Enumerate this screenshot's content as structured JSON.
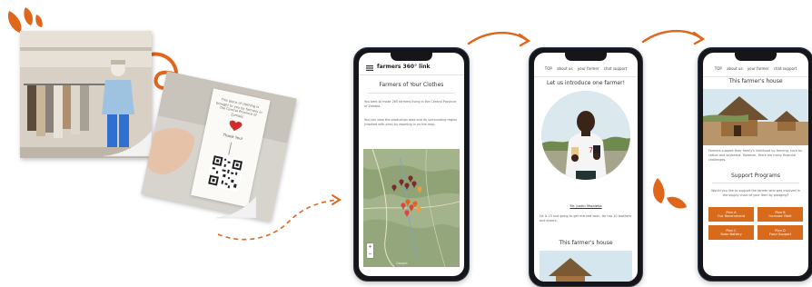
{
  "tag_card": {
    "note": "This piece of clothing is brought to you by farmers in the Central Province of Zambia.",
    "thanks": "Thank You!"
  },
  "phone1": {
    "brand": "farmers 360° link",
    "section_title": "Farmers of Your Clothes",
    "intro": "You bent to make 265 farmers living in the Central Province of Zambia.",
    "map_hint": "You can view the production area and its surrounding region (marked with pins) by zooming in on the map.",
    "zoom_in": "+",
    "zoom_out": "−",
    "map_credit": "Google"
  },
  "phone2": {
    "nav": [
      "TOP",
      "about us",
      "your farmer",
      "chat support"
    ],
    "title": "Let us introduce one farmer!",
    "farmer_name": "Mr. Justin Mwaleka",
    "bio": "He is 23 and going to get married soon. He has 10 brothers and sisters.",
    "house_title": "This farmer's house"
  },
  "phone3": {
    "nav": [
      "TOP",
      "about us",
      "your farmer",
      "chat support"
    ],
    "house_title": "This farmer's house",
    "desc": "Farmers support their family's livelihood by farming, such as cotton and soybeans. However, there are many financial challenges.",
    "support_title": "Support Programs",
    "support_text": "Would you like to support the farmer who was involved in the supply chain of your item by pledging?",
    "plans": [
      {
        "name": "Plan A",
        "desc": "Our Recommend"
      },
      {
        "name": "Plan B",
        "desc": "Increase Yield"
      },
      {
        "name": "Plan C",
        "desc": "Solar Battery"
      },
      {
        "name": "Plan D",
        "desc": "Food Support"
      }
    ]
  },
  "colors": {
    "accent": "#e0661c",
    "plan_bg": "#d86a1c",
    "phone_frame": "#16161a"
  },
  "icons": [
    "hamburger-menu-icon",
    "map-pin-icon",
    "heart-icon",
    "qr-code-icon",
    "arrow-icon",
    "splash-decoration"
  ]
}
